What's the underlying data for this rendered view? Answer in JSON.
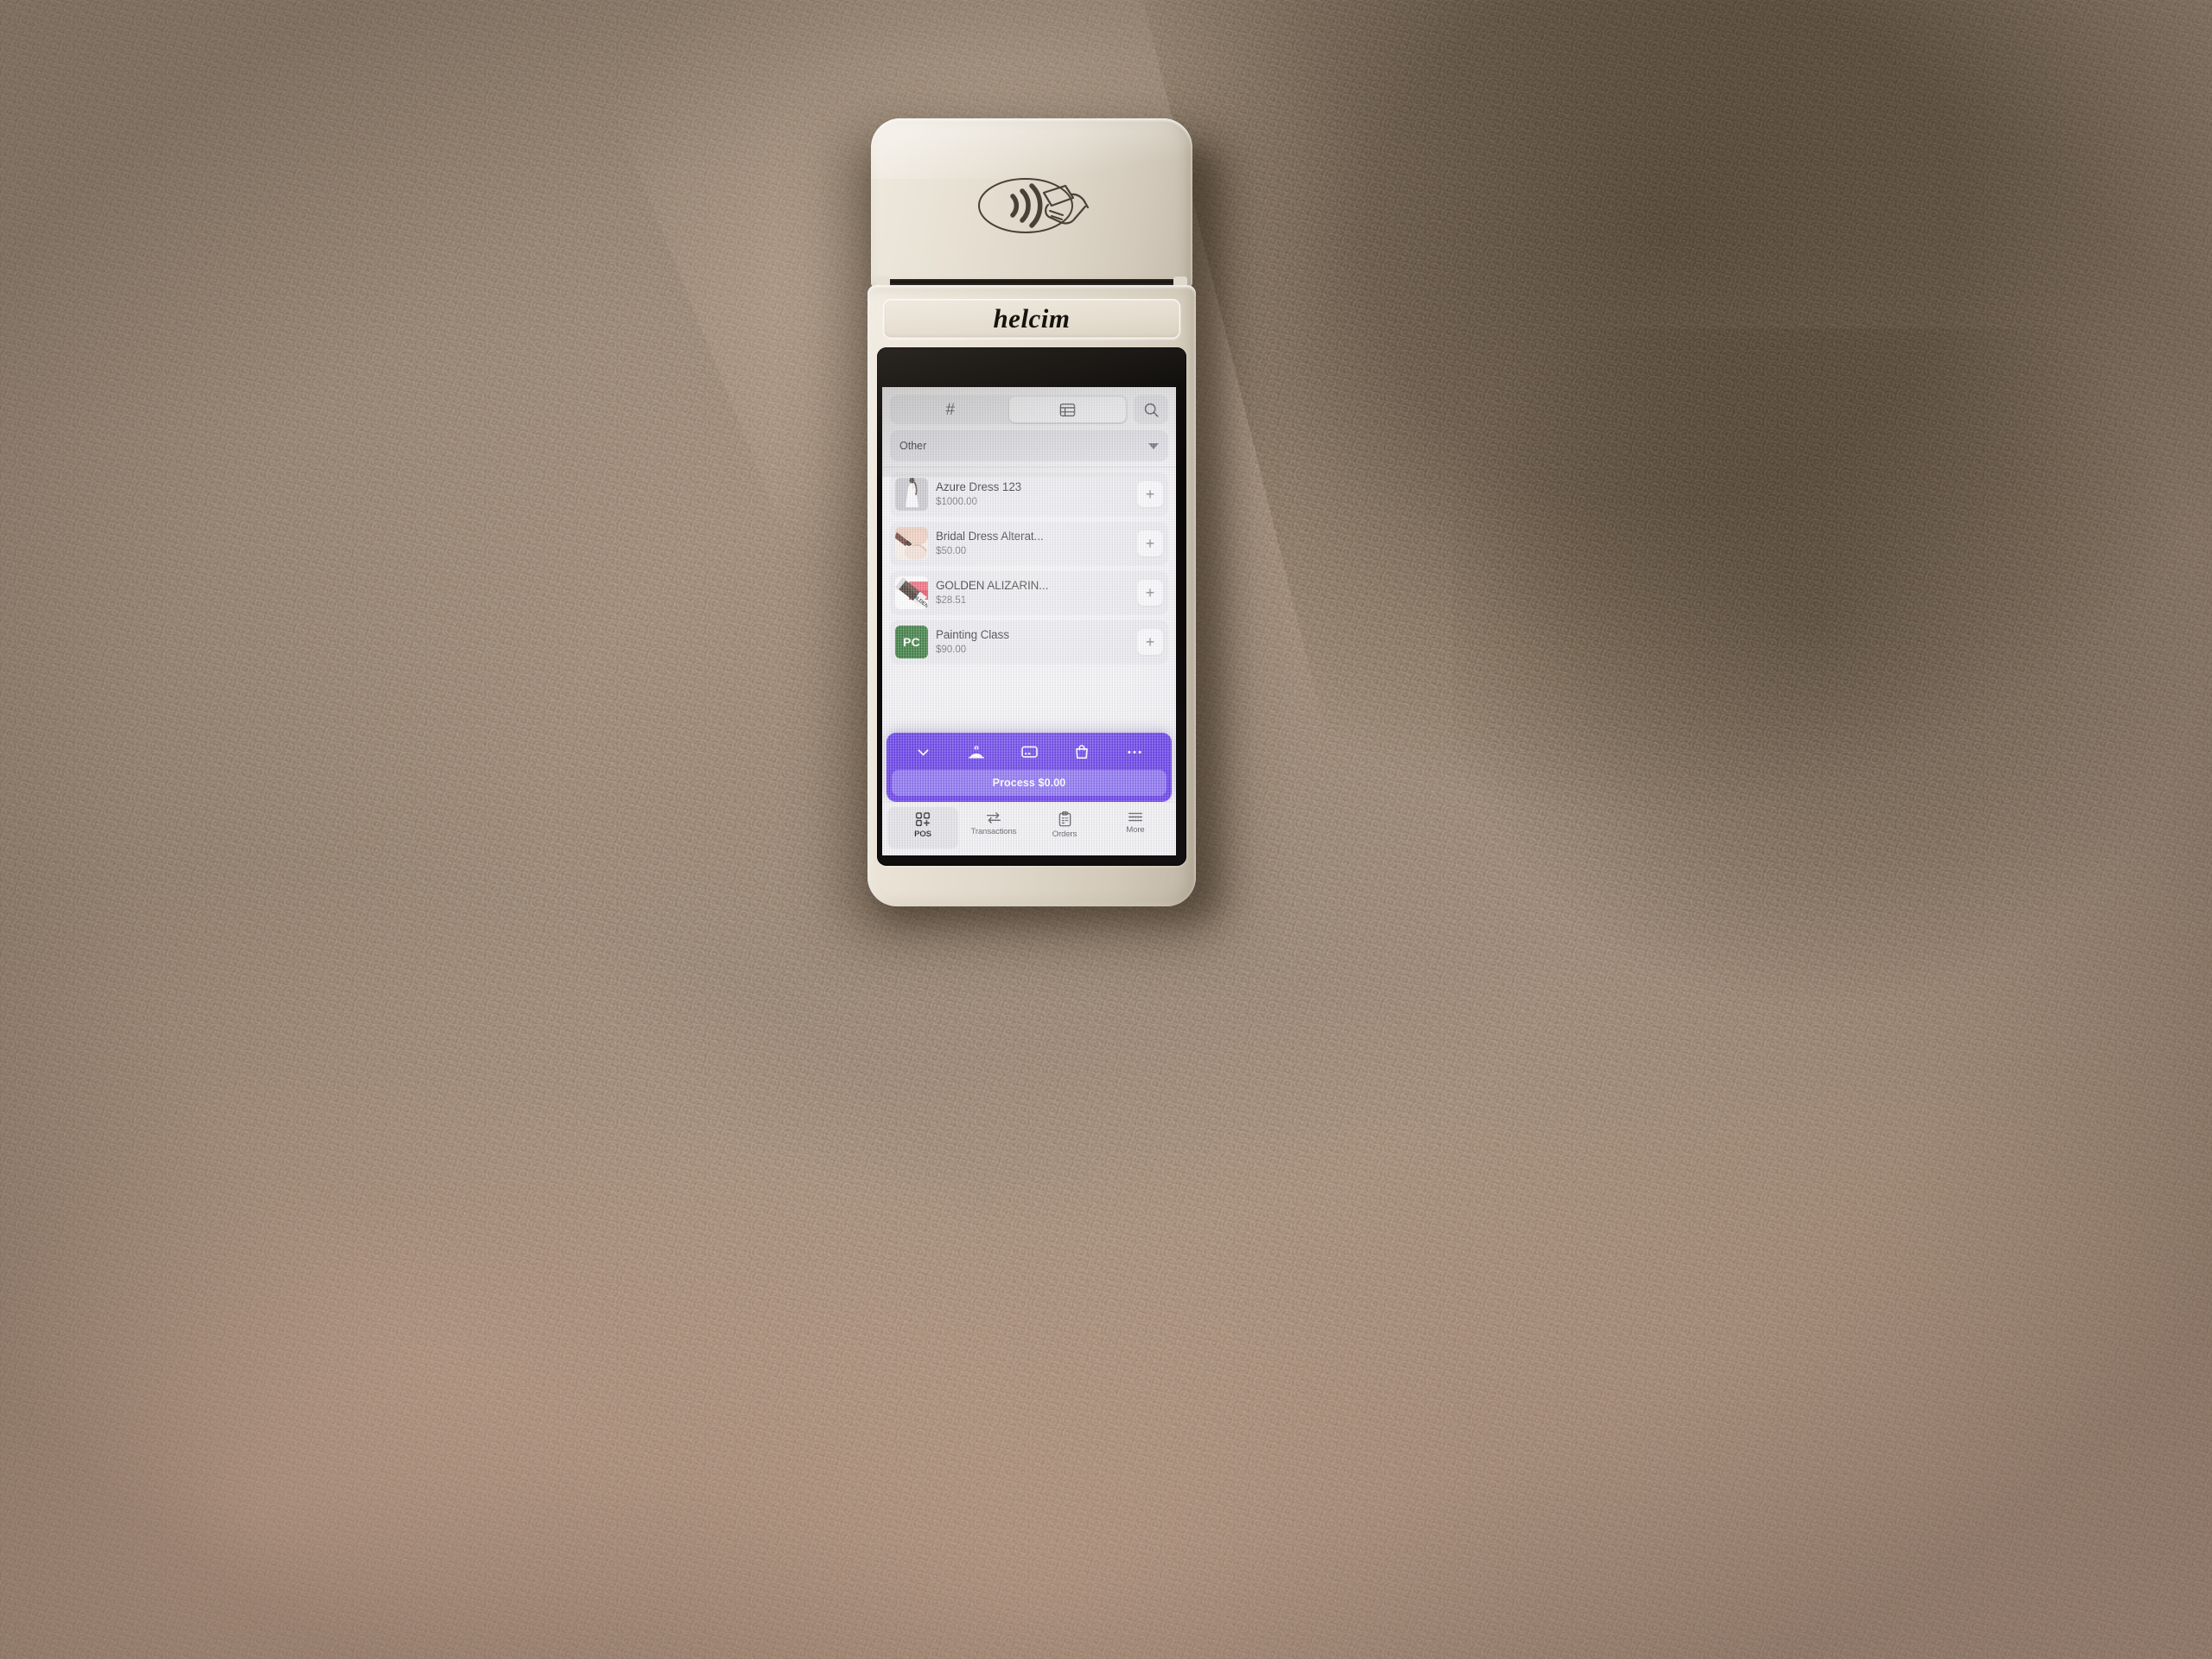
{
  "scene": {
    "setting": "payment-terminal-mounted-on-textured-beige-wall",
    "wall_color": "#a79685",
    "wall_shadow_color": "#5a4f3a",
    "wall_highlight_color": "#c9a892"
  },
  "device": {
    "brand": "helcim",
    "type": "card-payment-terminal",
    "body_color": "#e6ded0",
    "bezel_color": "#0d0b0a",
    "contactless_symbol": "nfc-contactless-icon"
  },
  "app": {
    "accent_color": "#5b2fe8",
    "accent_light_color": "#8468f2",
    "background_color": "#f3f3f6",
    "header": {
      "segmented": [
        {
          "icon": "hash-keypad-icon",
          "selected": false
        },
        {
          "icon": "table-grid-icon",
          "selected": true
        }
      ],
      "search_icon": "search-icon",
      "category": {
        "value": "Other",
        "caret_icon": "chevron-down-icon"
      }
    },
    "products": [
      {
        "name": "Azure Dress 123",
        "price": "$1000.00",
        "thumb_type": "photo",
        "thumb_kind": "wedding-dress-photo",
        "add_icon": "plus-icon"
      },
      {
        "name": "Bridal Dress Alterat...",
        "price": "$50.00",
        "thumb_type": "photo",
        "thumb_kind": "dress-alteration-photo",
        "add_icon": "plus-icon"
      },
      {
        "name": "GOLDEN ALIZARIN...",
        "price": "$28.51",
        "thumb_type": "photo",
        "thumb_kind": "paint-tube-photo",
        "add_icon": "plus-icon"
      },
      {
        "name": "Painting Class",
        "price": "$90.00",
        "thumb_type": "initials",
        "thumb_initials": "PC",
        "thumb_color": "#1f6b25",
        "add_icon": "plus-icon"
      }
    ],
    "cart_bar": {
      "icons": [
        {
          "name": "chevron-down-icon"
        },
        {
          "name": "tip-hand-icon"
        },
        {
          "name": "card-reader-icon"
        },
        {
          "name": "shopping-bag-icon"
        },
        {
          "name": "more-ellipsis-icon"
        }
      ],
      "process_label": "Process $0.00"
    },
    "tabs": [
      {
        "label": "POS",
        "icon": "grid-plus-icon",
        "selected": true
      },
      {
        "label": "Transactions",
        "icon": "transfer-arrows-icon",
        "selected": false
      },
      {
        "label": "Orders",
        "icon": "clipboard-icon",
        "selected": false
      },
      {
        "label": "More",
        "icon": "hamburger-menu-icon",
        "selected": false
      }
    ]
  }
}
